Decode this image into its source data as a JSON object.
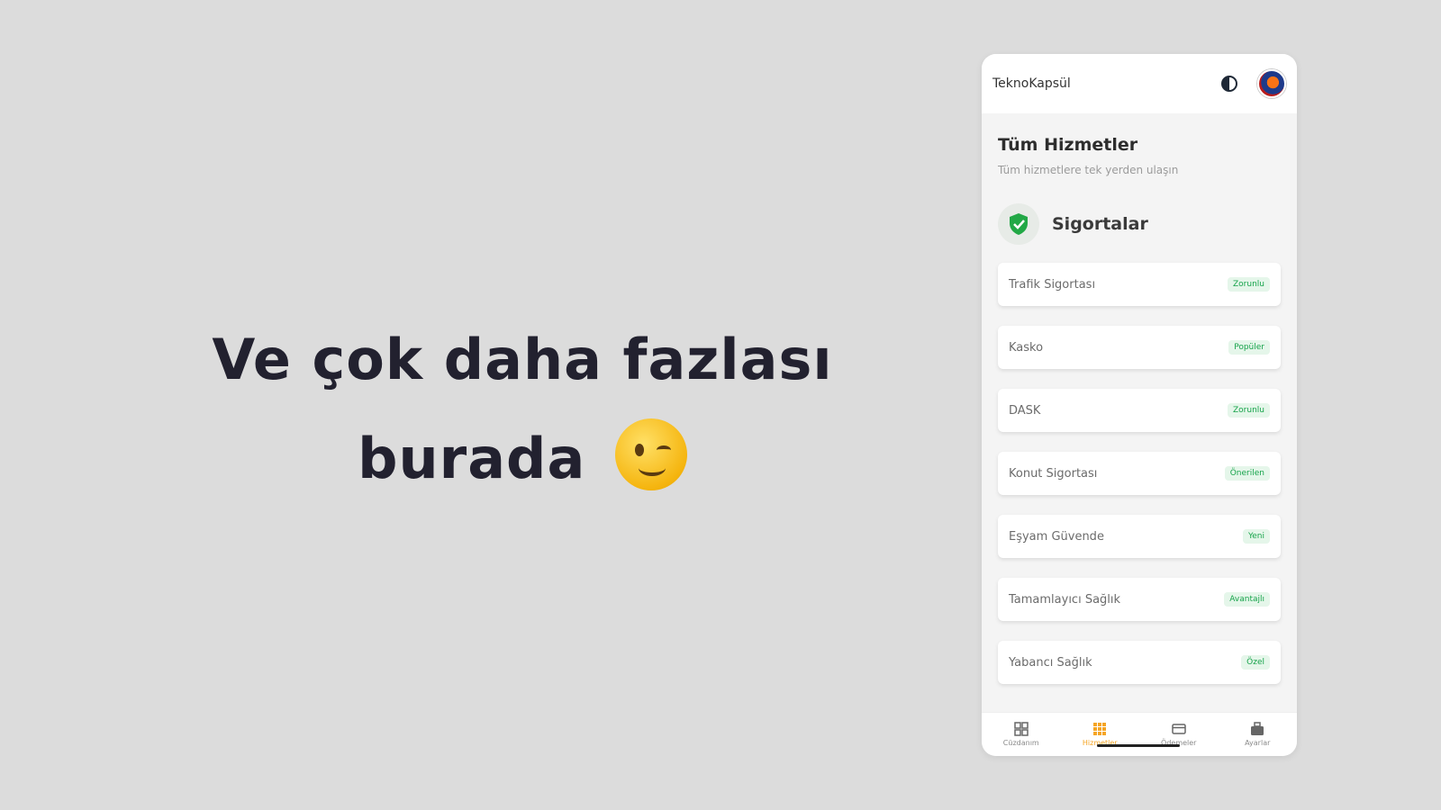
{
  "headline": {
    "line1": "Ve çok daha fazlası",
    "line2": "burada"
  },
  "app": {
    "title": "TeknoKapsül"
  },
  "page": {
    "title": "Tüm Hizmetler",
    "subtitle": "Tüm hizmetlere tek yerden ulaşın"
  },
  "section": {
    "title": "Sigortalar",
    "items": [
      {
        "label": "Trafik Sigortası",
        "badge": "Zorunlu"
      },
      {
        "label": "Kasko",
        "badge": "Popüler"
      },
      {
        "label": "DASK",
        "badge": "Zorunlu"
      },
      {
        "label": "Konut Sigortası",
        "badge": "Önerilen"
      },
      {
        "label": "Eşyam Güvende",
        "badge": "Yeni"
      },
      {
        "label": "Tamamlayıcı Sağlık",
        "badge": "Avantajlı"
      },
      {
        "label": "Yabancı Sağlık",
        "badge": "Özel"
      }
    ]
  },
  "nav": {
    "items": [
      {
        "label": "Cüzdanım"
      },
      {
        "label": "Hizmetler"
      },
      {
        "label": "Ödemeler"
      },
      {
        "label": "Ayarlar"
      }
    ]
  },
  "colors": {
    "accent": "#f5a524",
    "badge_text": "#16a34a",
    "badge_bg": "#e5f6ea",
    "shield": "#22a846"
  },
  "icons": {
    "theme": "theme-toggle-icon",
    "section": "shield-check-icon",
    "emoji": "winking-face-emoji"
  }
}
